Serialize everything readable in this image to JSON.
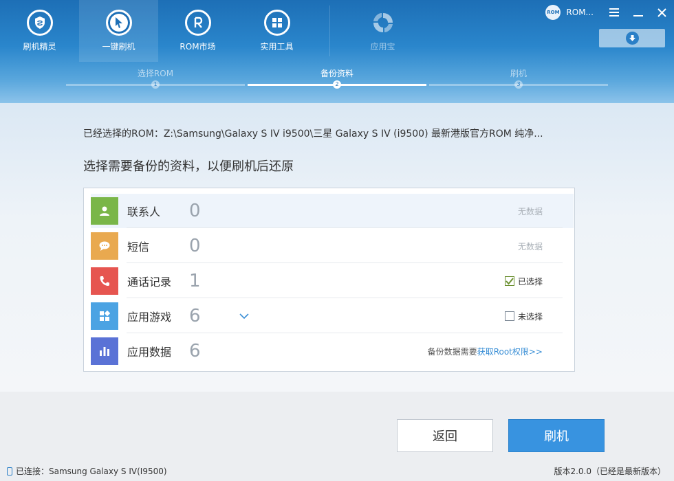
{
  "nav": {
    "items": [
      {
        "label": "刷机精灵",
        "icon": "shield-icon"
      },
      {
        "label": "一键刷机",
        "icon": "cursor-icon"
      },
      {
        "label": "ROM市场",
        "icon": "rom-market-icon"
      },
      {
        "label": "实用工具",
        "icon": "grid-icon"
      },
      {
        "label": "应用宝",
        "icon": "app-store-icon"
      }
    ],
    "active_index": 1
  },
  "window": {
    "avatar_text": "ROM",
    "user_label": "ROM..."
  },
  "steps": [
    {
      "label": "选择ROM",
      "num": "1"
    },
    {
      "label": "备份资料",
      "num": "2"
    },
    {
      "label": "刷机",
      "num": "3"
    }
  ],
  "main": {
    "rom_path": "已经选择的ROM：Z:\\Samsung\\Galaxy S IV i9500\\三星 Galaxy S IV (i9500) 最新港版官方ROM 纯净...",
    "instruction": "选择需要备份的资料，以便刷机后还原"
  },
  "backup_items": [
    {
      "name": "联系人",
      "count": "0",
      "status": "无数据",
      "color": "#7ab648",
      "icon": "contact-icon"
    },
    {
      "name": "短信",
      "count": "0",
      "status": "无数据",
      "color": "#e9a94f",
      "icon": "message-icon"
    },
    {
      "name": "通话记录",
      "count": "1",
      "status": "已选择",
      "color": "#e65550",
      "icon": "phone-icon"
    },
    {
      "name": "应用游戏",
      "count": "6",
      "status": "未选择",
      "color": "#4ba3e3",
      "icon": "apps-icon"
    },
    {
      "name": "应用数据",
      "count": "6",
      "status": "",
      "color": "#5a72d6",
      "icon": "bar-chart-icon"
    }
  ],
  "root_note": {
    "prefix": "备份数据需要",
    "link": "获取Root权限>>"
  },
  "actions": {
    "back": "返回",
    "flash": "刷机"
  },
  "status_bar": {
    "connected": "已连接：Samsung Galaxy S IV(I9500)",
    "version": "版本2.0.0（已经是最新版本）"
  }
}
